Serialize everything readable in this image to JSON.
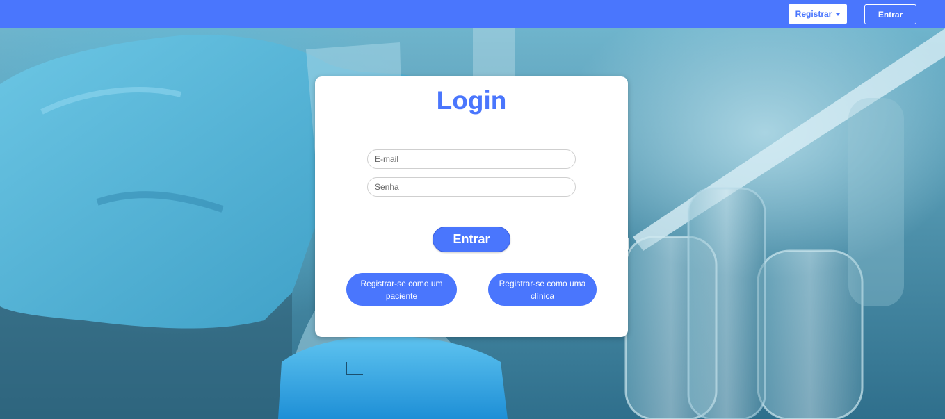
{
  "navbar": {
    "register_dropdown_label": "Registrar",
    "login_label": "Entrar"
  },
  "login_card": {
    "title": "Login",
    "email_placeholder": "E-mail",
    "password_placeholder": "Senha",
    "submit_label": "Entrar",
    "register_patient_label": "Registrar-se como um paciente",
    "register_clinic_label": "Registrar-se como uma clínica"
  },
  "colors": {
    "primary": "#4a76fd",
    "card_background": "#ffffff"
  },
  "icons": {
    "dropdown": "caret-down-icon"
  }
}
